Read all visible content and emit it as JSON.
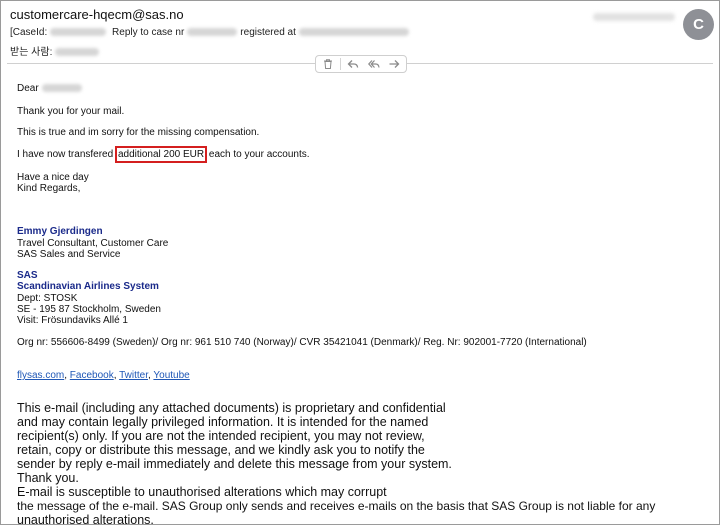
{
  "header": {
    "from": "customercare-hqecm@sas.no",
    "case_prefix": "[CaseId:",
    "case_middle": "Reply to case nr",
    "case_suffix": "registered at",
    "recipient_label": "받는 사람:",
    "avatar_letter": "C"
  },
  "toolbar": {
    "icons": [
      "trash-icon",
      "reply-icon",
      "reply-all-icon",
      "forward-icon"
    ]
  },
  "message": {
    "salutation": "Dear",
    "line1": "Thank you for your mail.",
    "line2": "This is true and im sorry for the missing compensation.",
    "line3_before": "I have now transfered ",
    "line3_highlight": "additional 200 EUR",
    "line3_after": " each to your accounts.",
    "closing1": "Have a nice day",
    "closing2": "Kind Regards,"
  },
  "signature": {
    "name": "Emmy Gjerdingen",
    "title": "Travel Consultant, Customer Care",
    "department": "SAS Sales and Service",
    "company_short": "SAS",
    "company_full": "Scandinavian Airlines System",
    "dept": "Dept: STOSK",
    "address": "SE - 195 87 Stockholm, Sweden",
    "visit": "Visit: Frösundaviks Allé 1",
    "org_numbers": "Org nr: 556606-8499 (Sweden)/ Org nr: 961 510 740 (Norway)/ CVR 35421041 (Denmark)/ Reg. Nr: 902001-7720 (International)"
  },
  "links": [
    "flysas.com",
    "Facebook",
    "Twitter",
    "Youtube"
  ],
  "disclaimer": [
    " This e-mail (including any attached documents) is proprietary and confidential",
    "and may contain legally privileged information. It is intended for the named",
    "recipient(s) only. If you are not the intended recipient, you may not review,",
    "retain, copy or distribute this message, and we kindly ask you to notify the",
    "sender by reply e-mail immediately and delete this message from your system.",
    "Thank you.",
    "E-mail is susceptible to unauthorised alterations which may corrupt",
    "the message of the e-mail. SAS Group only sends and receives e-mails on the basis that SAS Group is not liable for any",
    "unauthorised alterations."
  ],
  "colors": {
    "highlight_border": "#d41f1f",
    "signature_navy": "#1a2a8a",
    "link_blue": "#1f57b6",
    "avatar_gray": "#8e9096"
  }
}
